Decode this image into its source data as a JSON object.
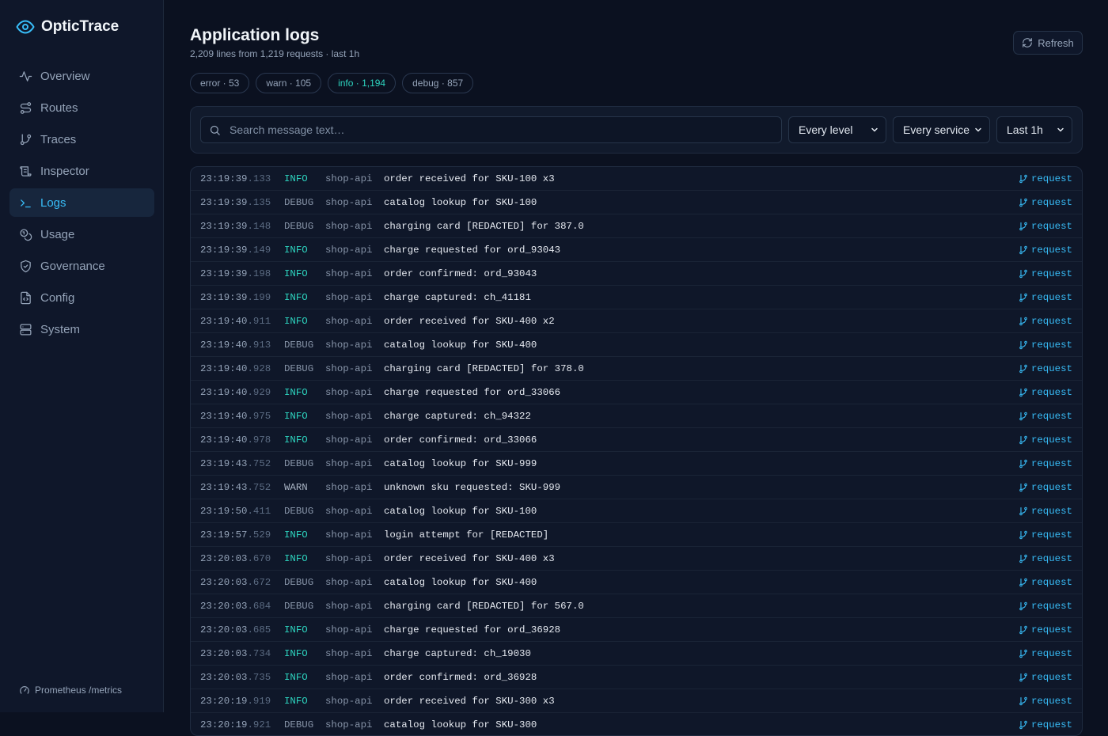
{
  "app": {
    "name": "OpticTrace"
  },
  "nav": [
    {
      "label": "Overview",
      "icon": "activity-icon",
      "active": false
    },
    {
      "label": "Routes",
      "icon": "route-icon",
      "active": false
    },
    {
      "label": "Traces",
      "icon": "git-branch-icon",
      "active": false
    },
    {
      "label": "Inspector",
      "icon": "scroll-icon",
      "active": false
    },
    {
      "label": "Logs",
      "icon": "terminal-icon",
      "active": true
    },
    {
      "label": "Usage",
      "icon": "coins-icon",
      "active": false
    },
    {
      "label": "Governance",
      "icon": "shield-icon",
      "active": false
    },
    {
      "label": "Config",
      "icon": "file-code-icon",
      "active": false
    },
    {
      "label": "System",
      "icon": "server-icon",
      "active": false
    }
  ],
  "footer": {
    "label": "Prometheus /metrics"
  },
  "header": {
    "title": "Application logs",
    "subtitle": "2,209 lines from 1,219 requests · last 1h",
    "refresh_label": "Refresh"
  },
  "chips": [
    {
      "label": "error · 53",
      "active": false
    },
    {
      "label": "warn · 105",
      "active": false
    },
    {
      "label": "info · 1,194",
      "active": true
    },
    {
      "label": "debug · 857",
      "active": false
    }
  ],
  "filters": {
    "search_placeholder": "Search message text…",
    "search_value": "",
    "level": "Every level",
    "service": "Every service",
    "range": "Last 1h"
  },
  "colors": {
    "accent": "#38bdf8",
    "info": "#2dd4bf",
    "bg": "#0b1120",
    "sidebar": "#0f172a"
  },
  "logs": [
    {
      "time": "23:19:39",
      "ms": ".133",
      "level": "INFO",
      "service": "shop-api",
      "message": "order received for SKU-100 x3",
      "link": "request"
    },
    {
      "time": "23:19:39",
      "ms": ".135",
      "level": "DEBUG",
      "service": "shop-api",
      "message": "catalog lookup for SKU-100",
      "link": "request"
    },
    {
      "time": "23:19:39",
      "ms": ".148",
      "level": "DEBUG",
      "service": "shop-api",
      "message": "charging card [REDACTED] for 387.0",
      "link": "request"
    },
    {
      "time": "23:19:39",
      "ms": ".149",
      "level": "INFO",
      "service": "shop-api",
      "message": "charge requested for ord_93043",
      "link": "request"
    },
    {
      "time": "23:19:39",
      "ms": ".198",
      "level": "INFO",
      "service": "shop-api",
      "message": "order confirmed: ord_93043",
      "link": "request"
    },
    {
      "time": "23:19:39",
      "ms": ".199",
      "level": "INFO",
      "service": "shop-api",
      "message": "charge captured: ch_41181",
      "link": "request"
    },
    {
      "time": "23:19:40",
      "ms": ".911",
      "level": "INFO",
      "service": "shop-api",
      "message": "order received for SKU-400 x2",
      "link": "request"
    },
    {
      "time": "23:19:40",
      "ms": ".913",
      "level": "DEBUG",
      "service": "shop-api",
      "message": "catalog lookup for SKU-400",
      "link": "request"
    },
    {
      "time": "23:19:40",
      "ms": ".928",
      "level": "DEBUG",
      "service": "shop-api",
      "message": "charging card [REDACTED] for 378.0",
      "link": "request"
    },
    {
      "time": "23:19:40",
      "ms": ".929",
      "level": "INFO",
      "service": "shop-api",
      "message": "charge requested for ord_33066",
      "link": "request"
    },
    {
      "time": "23:19:40",
      "ms": ".975",
      "level": "INFO",
      "service": "shop-api",
      "message": "charge captured: ch_94322",
      "link": "request"
    },
    {
      "time": "23:19:40",
      "ms": ".978",
      "level": "INFO",
      "service": "shop-api",
      "message": "order confirmed: ord_33066",
      "link": "request"
    },
    {
      "time": "23:19:43",
      "ms": ".752",
      "level": "DEBUG",
      "service": "shop-api",
      "message": "catalog lookup for SKU-999",
      "link": "request"
    },
    {
      "time": "23:19:43",
      "ms": ".752",
      "level": "WARN",
      "service": "shop-api",
      "message": "unknown sku requested: SKU-999",
      "link": "request"
    },
    {
      "time": "23:19:50",
      "ms": ".411",
      "level": "DEBUG",
      "service": "shop-api",
      "message": "catalog lookup for SKU-100",
      "link": "request"
    },
    {
      "time": "23:19:57",
      "ms": ".529",
      "level": "INFO",
      "service": "shop-api",
      "message": "login attempt for [REDACTED]",
      "link": "request"
    },
    {
      "time": "23:20:03",
      "ms": ".670",
      "level": "INFO",
      "service": "shop-api",
      "message": "order received for SKU-400 x3",
      "link": "request"
    },
    {
      "time": "23:20:03",
      "ms": ".672",
      "level": "DEBUG",
      "service": "shop-api",
      "message": "catalog lookup for SKU-400",
      "link": "request"
    },
    {
      "time": "23:20:03",
      "ms": ".684",
      "level": "DEBUG",
      "service": "shop-api",
      "message": "charging card [REDACTED] for 567.0",
      "link": "request"
    },
    {
      "time": "23:20:03",
      "ms": ".685",
      "level": "INFO",
      "service": "shop-api",
      "message": "charge requested for ord_36928",
      "link": "request"
    },
    {
      "time": "23:20:03",
      "ms": ".734",
      "level": "INFO",
      "service": "shop-api",
      "message": "charge captured: ch_19030",
      "link": "request"
    },
    {
      "time": "23:20:03",
      "ms": ".735",
      "level": "INFO",
      "service": "shop-api",
      "message": "order confirmed: ord_36928",
      "link": "request"
    },
    {
      "time": "23:20:19",
      "ms": ".919",
      "level": "INFO",
      "service": "shop-api",
      "message": "order received for SKU-300 x3",
      "link": "request"
    },
    {
      "time": "23:20:19",
      "ms": ".921",
      "level": "DEBUG",
      "service": "shop-api",
      "message": "catalog lookup for SKU-300",
      "link": "request"
    }
  ]
}
